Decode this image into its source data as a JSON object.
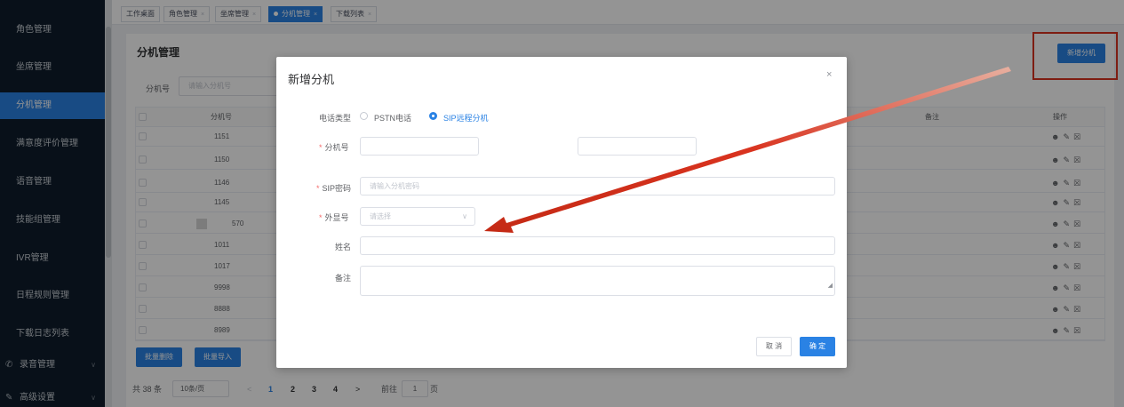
{
  "sidebar": {
    "items": [
      {
        "label": "角色管理",
        "active": false,
        "icon": ""
      },
      {
        "label": "坐席管理",
        "active": false,
        "icon": ""
      },
      {
        "label": "分机管理",
        "active": true,
        "icon": ""
      },
      {
        "label": "满意度评价管理",
        "active": false,
        "icon": ""
      },
      {
        "label": "语音管理",
        "active": false,
        "icon": ""
      },
      {
        "label": "技能组管理",
        "active": false,
        "icon": ""
      },
      {
        "label": "IVR管理",
        "active": false,
        "icon": ""
      },
      {
        "label": "日程规则管理",
        "active": false,
        "icon": ""
      },
      {
        "label": "下载日志列表",
        "active": false,
        "icon": ""
      },
      {
        "label": "录音管理",
        "active": false,
        "icon": "phone-icon"
      },
      {
        "label": "高级设置",
        "active": false,
        "icon": "wrench-icon"
      }
    ]
  },
  "tabs": [
    {
      "label": "工作桌面",
      "closable": false,
      "active": false
    },
    {
      "label": "角色管理",
      "closable": true,
      "active": false
    },
    {
      "label": "坐席管理",
      "closable": true,
      "active": false
    },
    {
      "label": "分机管理",
      "closable": true,
      "active": true
    },
    {
      "label": "下载列表",
      "closable": true,
      "active": false
    }
  ],
  "page": {
    "title": "分机管理",
    "add_button": "新增分机",
    "filter_label": "分机号",
    "filter_placeholder": "请输入分机号"
  },
  "table": {
    "headers": {
      "ext": "分机号",
      "remark": "备注",
      "ops": "操作"
    },
    "rows": [
      {
        "ext": "1151"
      },
      {
        "ext": "1150"
      },
      {
        "ext": "1146"
      },
      {
        "ext": "1145"
      },
      {
        "ext": "570"
      },
      {
        "ext": "1011"
      },
      {
        "ext": "1017"
      },
      {
        "ext": "9998"
      },
      {
        "ext": "8888"
      },
      {
        "ext": "8989"
      }
    ],
    "ops_icons": [
      "user-icon",
      "edit-icon",
      "trash-icon"
    ]
  },
  "bulk": {
    "delete": "批量删除",
    "import": "批量导入"
  },
  "pagination": {
    "total": "共 38 条",
    "page_size": "10条/页",
    "pages": [
      "1",
      "2",
      "3",
      "4"
    ],
    "current": "1",
    "goto_label": "前往",
    "goto_value": "1",
    "page_suffix": "页"
  },
  "modal": {
    "title": "新增分机",
    "close": "×",
    "phone_type_label": "电话类型",
    "phone_type_options": [
      "PSTN电话",
      "SIP远程分机"
    ],
    "phone_type_selected": "SIP远程分机",
    "ext_label": "分机号",
    "sip_password_label": "SIP密码",
    "sip_password_placeholder": "请输入分机密码",
    "display_number_label": "外显号",
    "display_number_placeholder": "请选择",
    "name_label": "姓名",
    "remark_label": "备注",
    "cancel": "取 消",
    "confirm": "确 定"
  },
  "colors": {
    "accent": "#2a82e4",
    "sidebar_bg": "#0f1d2b",
    "annotation_red": "#d9331f"
  }
}
